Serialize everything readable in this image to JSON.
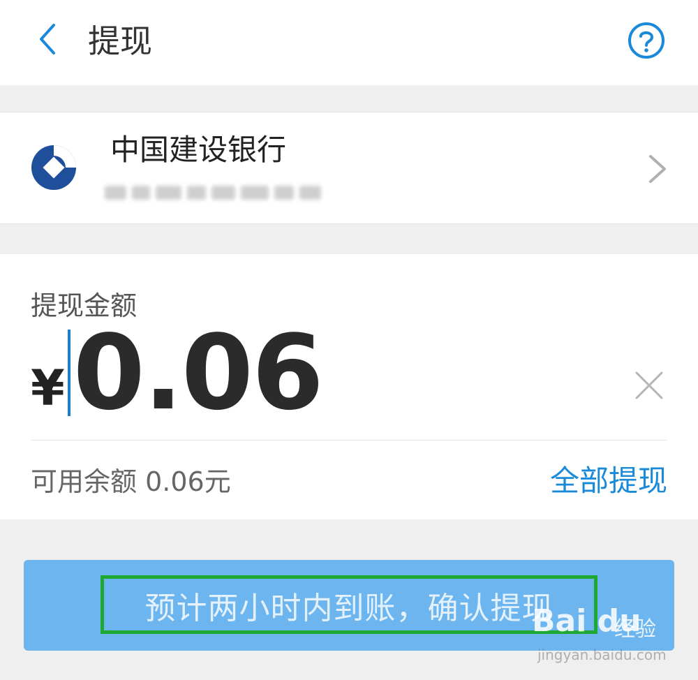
{
  "header": {
    "title": "提现"
  },
  "bank": {
    "name": "中国建设银行"
  },
  "amount": {
    "label": "提现金额",
    "currency_symbol": "¥",
    "value": "0.06"
  },
  "balance": {
    "available_text": "可用余额 0.06元",
    "withdraw_all_label": "全部提现"
  },
  "confirm": {
    "label": "预计两小时内到账，确认提现"
  },
  "watermark": {
    "logo": "Bai du",
    "cn": "经验",
    "url": "jingyan.baidu.com"
  },
  "colors": {
    "accent": "#1a8ad8",
    "button_bg": "#6db5ee",
    "highlight_box": "#1fa832",
    "bank_brand": "#1f4e9a"
  },
  "icons": {
    "back": "chevron-left-icon",
    "help": "question-circle-icon",
    "bank_logo": "ccb-logo-icon",
    "forward": "chevron-right-icon",
    "clear": "close-icon"
  }
}
